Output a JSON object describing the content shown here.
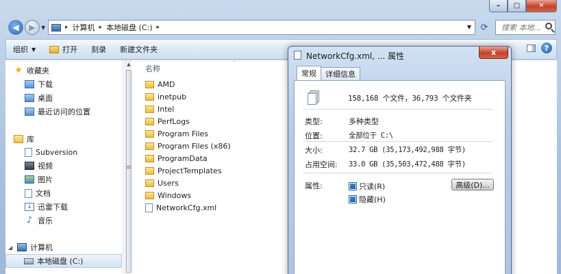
{
  "explorer": {
    "address": {
      "segments": [
        "计算机",
        "本地磁盘 (C:)"
      ]
    },
    "search": {
      "placeholder": "搜索 本地..."
    },
    "toolbar": {
      "organize": "组织",
      "open": "打开",
      "burn": "刻录",
      "new_folder": "新建文件夹"
    },
    "nav": {
      "favorites": "收藏夹",
      "downloads": "下载",
      "desktop": "桌面",
      "recent": "最近访问的位置",
      "libraries": "库",
      "subversion": "Subversion",
      "videos": "视频",
      "pictures": "图片",
      "documents": "文档",
      "thunder": "迅雷下载",
      "music": "音乐",
      "computer": "计算机",
      "local_disk": "本地磁盘 (C:)"
    },
    "files": {
      "column_name": "名称",
      "items": [
        "AMD",
        "inetpub",
        "Intel",
        "PerfLogs",
        "Program Files",
        "Program Files (x86)",
        "ProgramData",
        "ProjectTemplates",
        "Users",
        "Windows",
        "NetworkCfg.xml"
      ]
    }
  },
  "dialog": {
    "title": "NetworkCfg.xml, ... 属性",
    "close": "x",
    "tabs": {
      "general": "常规",
      "details": "详细信息"
    },
    "summary": "158,168 个文件，36,793 个文件夹",
    "props": {
      "type_label": "类型:",
      "type_value": "多种类型",
      "location_label": "位置:",
      "location_value": "全部位于 C:\\",
      "size_label": "大小:",
      "size_value": "32.7 GB (35,173,492,988 字节)",
      "disk_label": "占用空间:",
      "disk_value": "33.0 GB (35,503,472,488 字节)",
      "attr_label": "属性:",
      "readonly": "只读(R)",
      "hidden": "隐藏(H)",
      "advanced": "高级(D)..."
    }
  }
}
